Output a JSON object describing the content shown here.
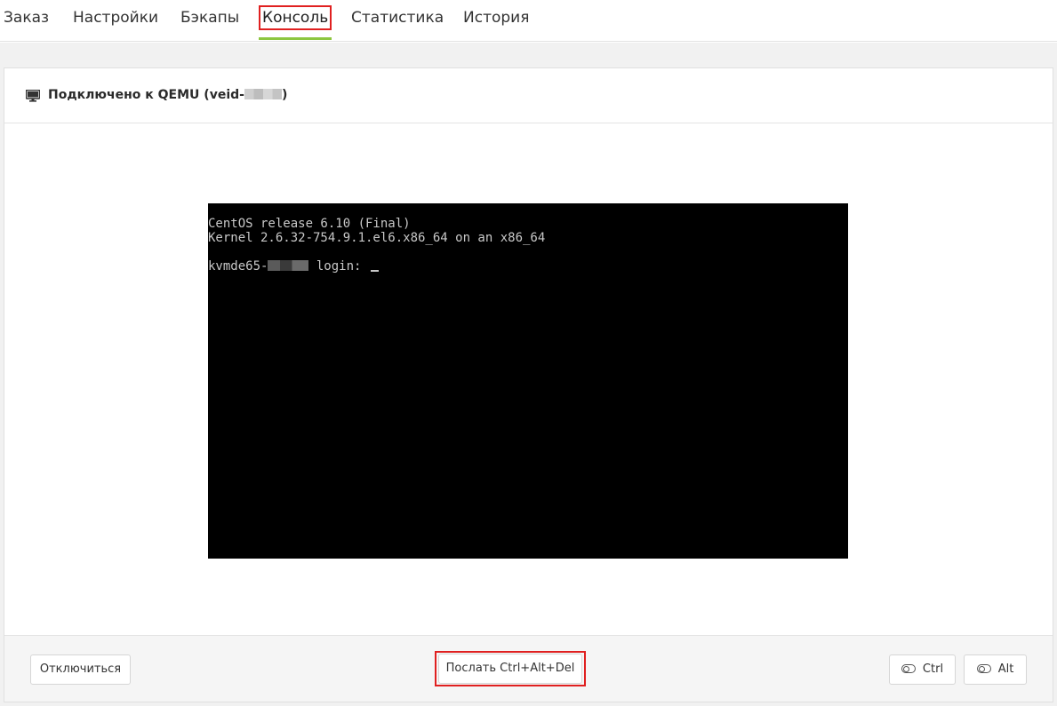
{
  "tabs": [
    {
      "label": "Заказ",
      "active": false
    },
    {
      "label": "Настройки",
      "active": false
    },
    {
      "label": "Бэкапы",
      "active": false
    },
    {
      "label": "Консоль",
      "active": true
    },
    {
      "label": "Статистика",
      "active": false
    },
    {
      "label": "История",
      "active": false
    }
  ],
  "panel": {
    "title_prefix": "Подключено к QEMU (veid-",
    "title_suffix": ")",
    "icon": "monitor-icon"
  },
  "console": {
    "line1": "CentOS release 6.10 (Final)",
    "line2": "Kernel 2.6.32-754.9.1.el6.x86_64 on an x86_64",
    "line3_prefix": "kvmde65-",
    "line3_suffix": " login: "
  },
  "footer": {
    "disconnect_label": "Отключиться",
    "send_cad_label": "Послать Ctrl+Alt+Del",
    "ctrl_label": "Ctrl",
    "alt_label": "Alt"
  },
  "colors": {
    "accent_underline": "#8dc63f",
    "highlight_red": "#e02020",
    "console_bg": "#000000"
  }
}
